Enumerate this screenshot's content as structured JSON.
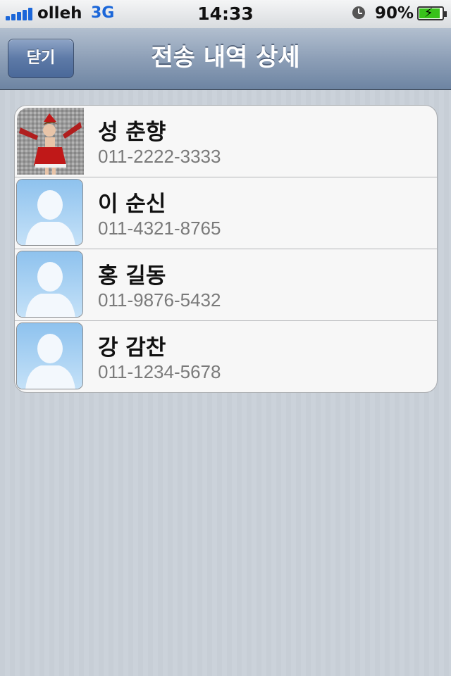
{
  "status_bar": {
    "carrier": "olleh",
    "network": "3G",
    "time": "14:33",
    "battery_percent": "90%",
    "signal_icon": "signal-bars-icon",
    "alarm_icon": "alarm-clock-icon",
    "battery_icon": "battery-charging-icon"
  },
  "navbar": {
    "back_label": "닫기",
    "title": "전송 내역 상세"
  },
  "contacts": [
    {
      "name": "성 춘향",
      "phone": "011-2222-3333",
      "avatar": "photo"
    },
    {
      "name": "이 순신",
      "phone": "011-4321-8765",
      "avatar": "default-silhouette"
    },
    {
      "name": "홍 길동",
      "phone": "011-9876-5432",
      "avatar": "default-silhouette"
    },
    {
      "name": "강 감찬",
      "phone": "011-1234-5678",
      "avatar": "default-silhouette"
    }
  ],
  "colors": {
    "nav_gradient_top": "#b2bfcf",
    "nav_gradient_bottom": "#6d84a2",
    "network_blue": "#1a66d9",
    "phone_gray": "#7a7a7a"
  }
}
